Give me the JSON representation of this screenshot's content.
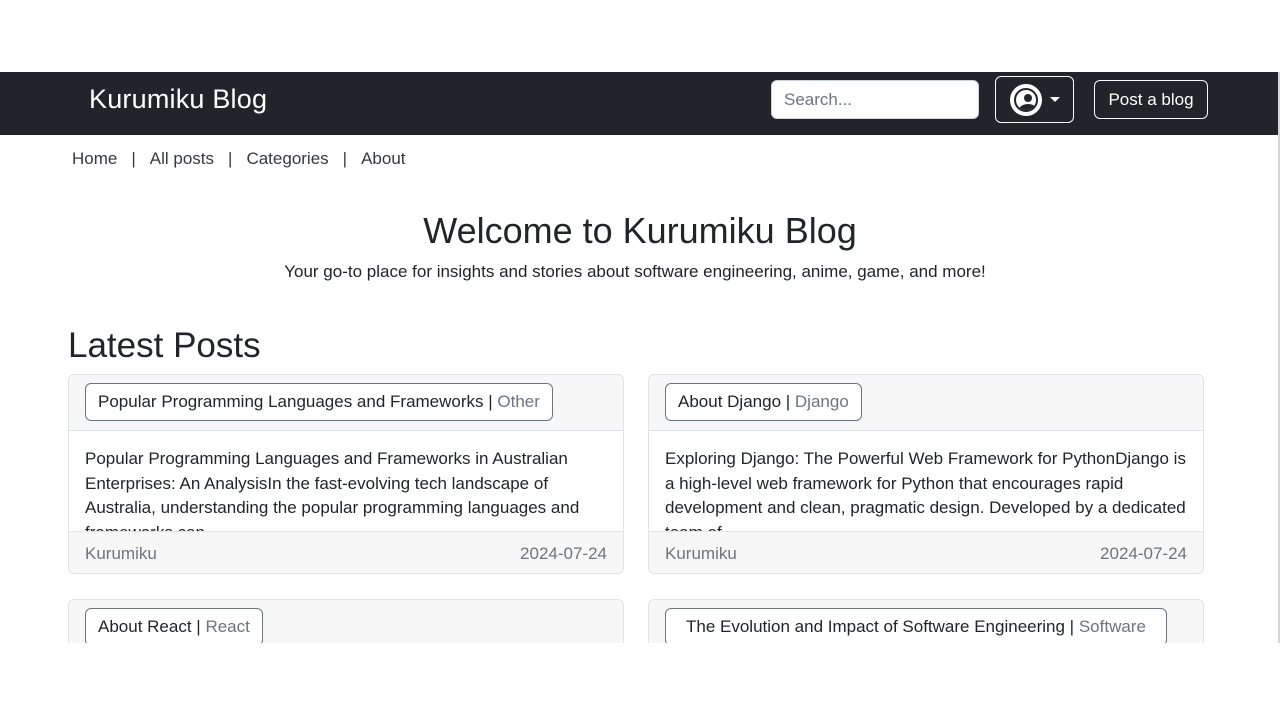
{
  "navbar": {
    "brand": "Kurumiku Blog",
    "search_placeholder": "Search...",
    "post_button": "Post a blog"
  },
  "subnav": {
    "items": [
      "Home",
      "All posts",
      "Categories",
      "About"
    ],
    "separator": "|"
  },
  "hero": {
    "title": "Welcome to Kurumiku Blog",
    "subtitle": "Your go-to place for insights and stories about software engineering, anime, game, and more!"
  },
  "latest": {
    "heading": "Latest Posts",
    "posts": [
      {
        "title": "Popular Programming Languages and Frameworks",
        "category": "Other",
        "excerpt": "Popular Programming Languages and Frameworks in Australian Enterprises: An AnalysisIn the fast-evolving tech landscape of Australia, understanding the popular programming languages and frameworks can...",
        "author": "Kurumiku",
        "date": "2024-07-24"
      },
      {
        "title": "About Django",
        "category": "Django",
        "excerpt": "Exploring Django: The Powerful Web Framework for PythonDjango is a high-level web framework for Python that encourages rapid development and clean, pragmatic design. Developed by a dedicated team of ...",
        "author": "Kurumiku",
        "date": "2024-07-24"
      },
      {
        "title": "About React",
        "category": "React"
      },
      {
        "title": "The Evolution and Impact of Software Engineering",
        "category": "Software"
      }
    ]
  },
  "colors": {
    "navbar_bg": "#212529",
    "muted": "#6c757d",
    "card_header_bg": "#f7f7f7"
  }
}
